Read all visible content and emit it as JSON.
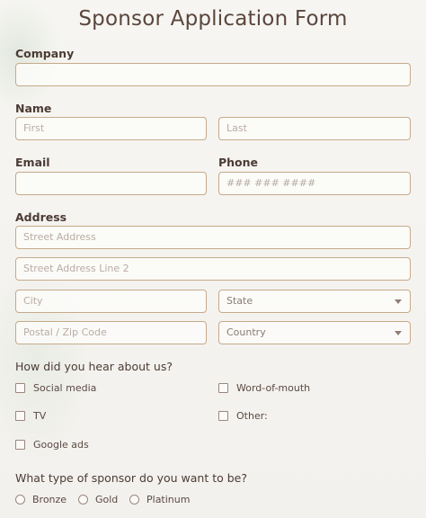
{
  "title": "Sponsor Application Form",
  "company": {
    "label": "Company",
    "value": ""
  },
  "name": {
    "label": "Name",
    "first_placeholder": "First",
    "last_placeholder": "Last"
  },
  "email": {
    "label": "Email",
    "value": ""
  },
  "phone": {
    "label": "Phone",
    "placeholder": "### ### ####"
  },
  "address": {
    "label": "Address",
    "street_placeholder": "Street Address",
    "street2_placeholder": "Street Address Line 2",
    "city_placeholder": "City",
    "state_select": "State",
    "zip_placeholder": "Postal / Zip Code",
    "country_select": "Country"
  },
  "hear": {
    "question": "How did you hear about us?",
    "options": [
      "Social media",
      "Word-of-mouth",
      "TV",
      "Other:",
      "Google ads"
    ]
  },
  "sponsor_type": {
    "question": "What type of sponsor do you want to be?",
    "options": [
      "Bronze",
      "Gold",
      "Platinum"
    ]
  },
  "colors": {
    "border": "#c6aa8a",
    "text": "#4b3b34",
    "background": "#f4f2ee"
  }
}
